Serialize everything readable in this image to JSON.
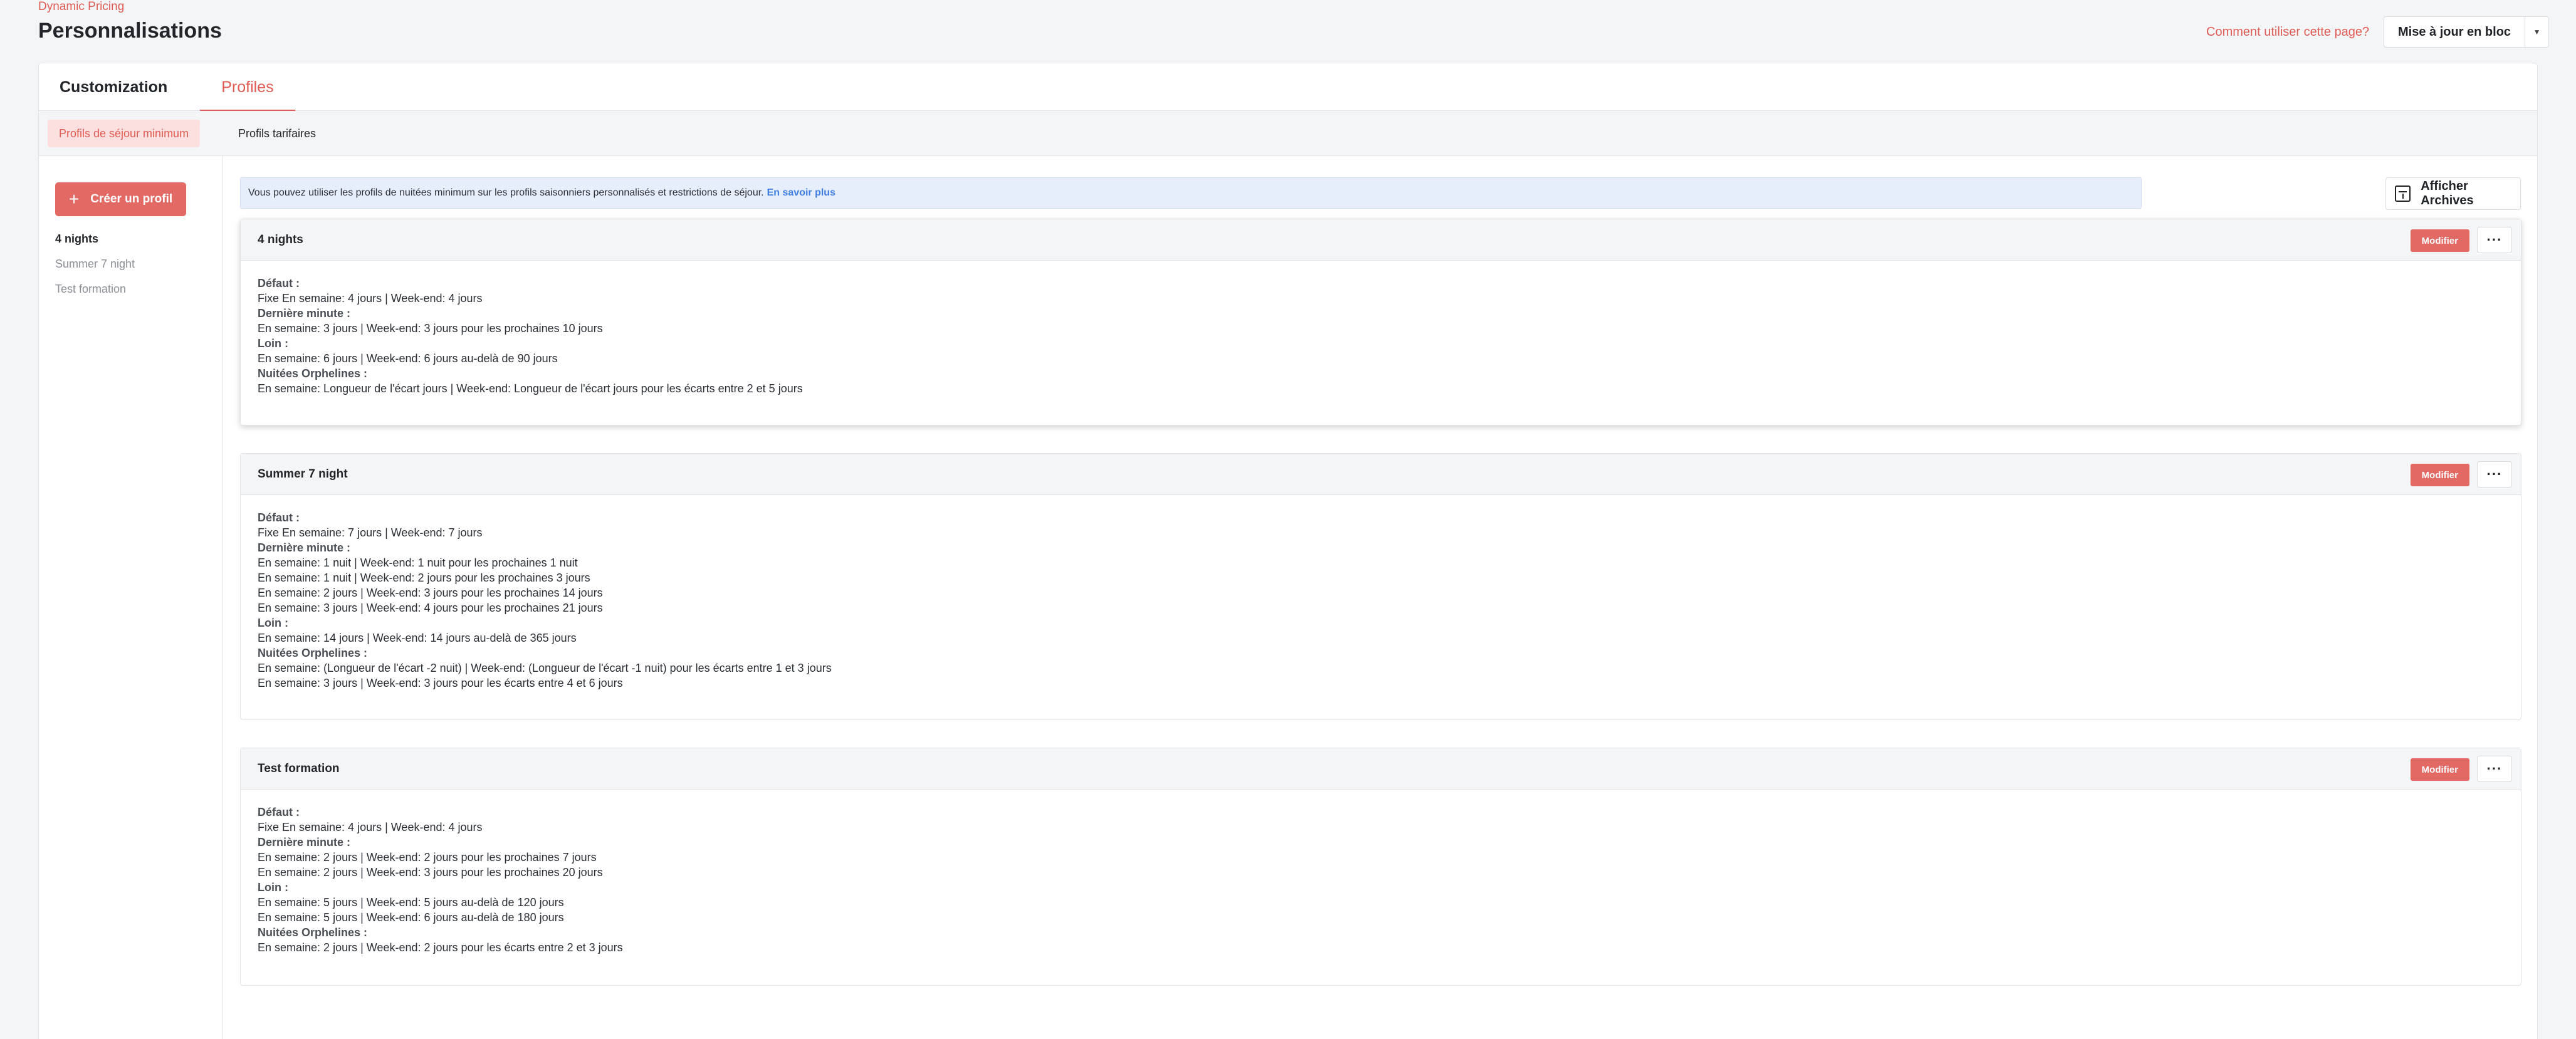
{
  "header": {
    "app_name": "Dynamic Pricing",
    "title": "Personnalisations",
    "help_link": "Comment utiliser cette page?",
    "bulk_update": "Mise à jour en bloc"
  },
  "tabs": {
    "customization": "Customization",
    "profiles": "Profiles"
  },
  "subtabs": {
    "min_stay": "Profils de séjour minimum",
    "pricing": "Profils tarifaires"
  },
  "sidebar": {
    "create_button": "Créer un profil",
    "items": [
      "4 nights",
      "Summer 7 night",
      "Test formation"
    ]
  },
  "info": {
    "text": "Vous pouvez utiliser les profils de nuitées minimum sur les profils saisonniers personnalisés et restrictions de séjour.",
    "link": "En savoir plus"
  },
  "archive_button": "Afficher Archives",
  "edit_label": "Modifier",
  "more_label": "···",
  "cards": [
    {
      "title": "4 nights",
      "lines": [
        "Défaut :",
        "Fixe En semaine: 4 jours | Week-end: 4 jours",
        "Dernière minute :",
        "En semaine: 3 jours | Week-end: 3 jours pour les prochaines 10 jours",
        "Loin :",
        "En semaine: 6 jours | Week-end: 6 jours au-delà de 90 jours",
        "Nuitées Orphelines :",
        "En semaine: Longueur de l'écart jours | Week-end: Longueur de l'écart jours pour les écarts entre 2 et 5 jours"
      ]
    },
    {
      "title": "Summer 7 night",
      "lines": [
        "Défaut :",
        "Fixe En semaine: 7 jours | Week-end: 7 jours",
        "Dernière minute :",
        "En semaine: 1 nuit | Week-end: 1 nuit pour les prochaines 1 nuit",
        "En semaine: 1 nuit | Week-end: 2 jours pour les prochaines 3 jours",
        "En semaine: 2 jours | Week-end: 3 jours pour les prochaines 14 jours",
        "En semaine: 3 jours | Week-end: 4 jours pour les prochaines 21 jours",
        "Loin :",
        "En semaine: 14 jours | Week-end: 14 jours au-delà de 365 jours",
        "Nuitées Orphelines :",
        "En semaine: (Longueur de l'écart -2 nuit) | Week-end: (Longueur de l'écart -1 nuit) pour les écarts entre 1 et 3 jours",
        "En semaine: 3 jours | Week-end: 3 jours pour les écarts entre 4 et 6 jours"
      ]
    },
    {
      "title": "Test formation",
      "lines": [
        "Défaut :",
        "Fixe En semaine: 4 jours | Week-end: 4 jours",
        "Dernière minute :",
        "En semaine: 2 jours | Week-end: 2 jours pour les prochaines 7 jours",
        "En semaine: 2 jours | Week-end: 3 jours pour les prochaines 20 jours",
        "Loin :",
        "En semaine: 5 jours | Week-end: 5 jours au-delà de 120 jours",
        "En semaine: 5 jours | Week-end: 6 jours au-delà de 180 jours",
        "Nuitées Orphelines :",
        "En semaine: 2 jours | Week-end: 2 jours pour les écarts entre 2 et 3 jours"
      ]
    }
  ]
}
